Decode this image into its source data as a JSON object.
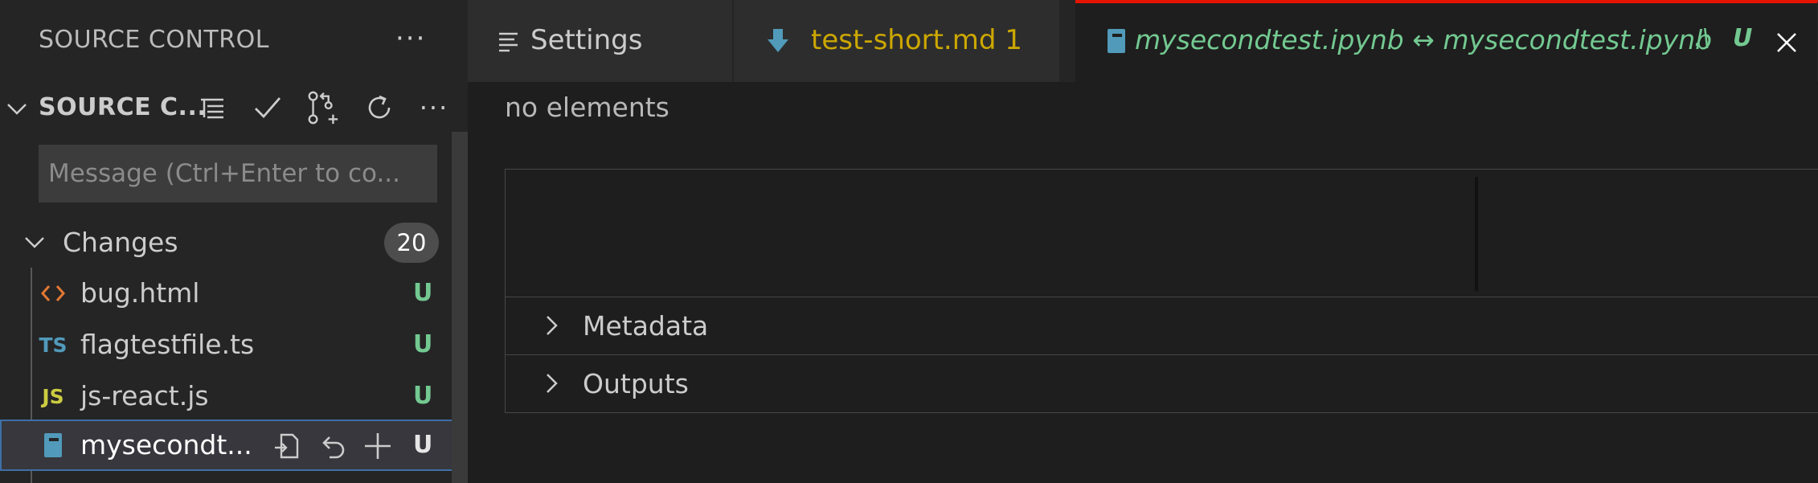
{
  "sidebar": {
    "title": "SOURCE CONTROL",
    "more": "···",
    "repo": {
      "name": "SOURCE C..."
    },
    "message": {
      "placeholder": "Message (Ctrl+Enter to co..."
    },
    "changes": {
      "label": "Changes",
      "count": "20"
    },
    "files": [
      {
        "name": "bug.html",
        "icon": "<>",
        "icon_color": "#e37933",
        "status": "U"
      },
      {
        "name": "flagtestfile.ts",
        "icon": "TS",
        "icon_color": "#519aba",
        "status": "U"
      },
      {
        "name": "js-react.js",
        "icon": "JS",
        "icon_color": "#cbcb41",
        "status": "U"
      },
      {
        "name": "mysecondt...",
        "icon": "notebook-icon",
        "icon_color": "#519aba",
        "status": "U",
        "selected": true
      }
    ]
  },
  "tabs": [
    {
      "label": "Settings",
      "icon": "settings-lines-icon"
    },
    {
      "label": "test-short.md 1",
      "icon": "arrow-down-icon",
      "label_color": "#cca700"
    },
    {
      "label": "mysecondtest.ipynb ↔ mysecondtest.ipynb",
      "path_hint": ".\\",
      "status": "U",
      "icon": "notebook-icon",
      "label_color": "#73c991",
      "active": true
    }
  ],
  "editor": {
    "empty_text": "no elements",
    "sections": [
      {
        "label": "Metadata"
      },
      {
        "label": "Outputs"
      }
    ]
  },
  "colors": {
    "accent_tab_border": "#e51400",
    "untracked": "#73c991",
    "warning": "#cca700"
  }
}
